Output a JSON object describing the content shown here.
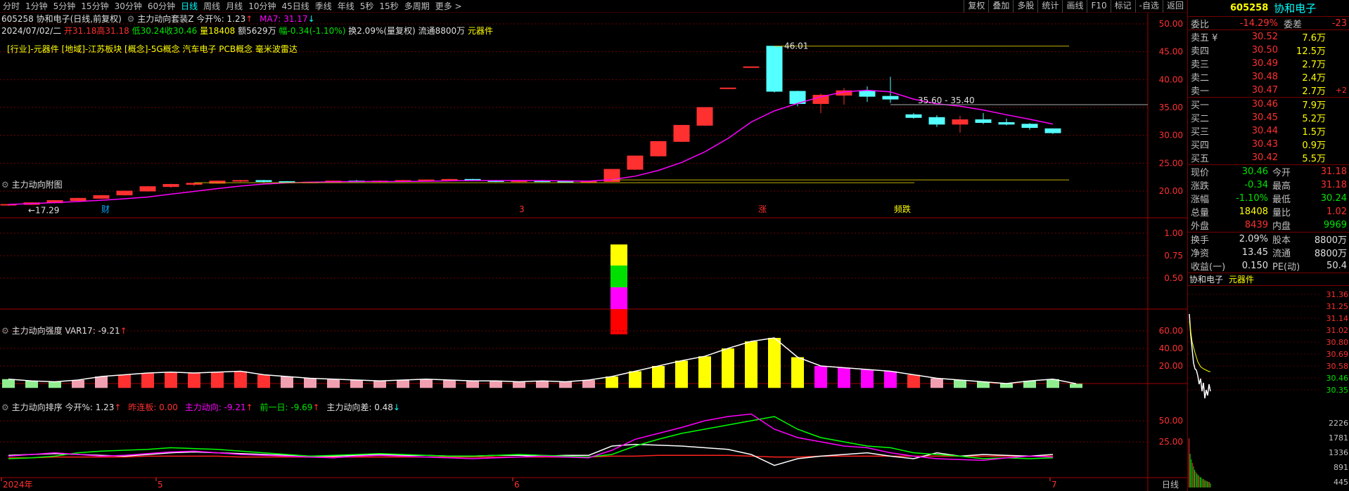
{
  "toolbar": {
    "periods": [
      "分时",
      "1分钟",
      "5分钟",
      "15分钟",
      "30分钟",
      "60分钟",
      "日线",
      "周线",
      "月线",
      "10分钟",
      "45日线",
      "季线",
      "年线",
      "5秒",
      "15秒",
      "多周期",
      "更多 >"
    ],
    "active_period": "日线",
    "tools": [
      "复权",
      "叠加",
      "多股",
      "统计",
      "画线",
      "F10",
      "标记",
      "-自选",
      "返回"
    ]
  },
  "main": {
    "title_stock": "605258 协和电子(日线,前复权)",
    "indicator": "主力动向套装Z",
    "open_pct_label": "今开%: 1.23",
    "ma_label": "MA7: 31.17",
    "quote": {
      "date": "2024/07/02/二",
      "open": "开31.18",
      "high": "高31.18",
      "low": "低30.24",
      "close": "收30.46",
      "vol": "量18408",
      "amount": "额5629万",
      "change": "幅-0.34(-1.10%)",
      "turnover": "换2.09%(量复权)",
      "float": "流通8800万",
      "sector": "元器件"
    },
    "concepts": "[行业]-元器件 [地域]-江苏板块 [概念]-5G概念 汽车电子 PCB概念 毫米波雷达",
    "annotations": {
      "high": "46.01",
      "range": "35.60 - 35.40",
      "low": "17.29"
    },
    "markers": [
      "财",
      "3",
      "涨",
      "频跌"
    ],
    "y_ticks": [
      "50.00",
      "45.00",
      "40.00",
      "35.00",
      "30.00",
      "25.00",
      "20.00"
    ]
  },
  "panels": {
    "fig1": {
      "title": "主力动向附图",
      "y_ticks": [
        "1.00",
        "0.75",
        "0.50"
      ]
    },
    "fig2": {
      "title": "主力动向强度",
      "var": "VAR17: -9.21",
      "y_ticks": [
        "60.00",
        "40.00",
        "20.00"
      ]
    },
    "fig3": {
      "title": "主力动向排序",
      "open": "今开%: 1.23",
      "streak": "昨连板: 0.00",
      "dir": "主力动向: -9.21",
      "prev": "前一日: -9.69",
      "diff": "主力动向差: 0.48",
      "y_ticks": [
        "50.00",
        "25.00"
      ]
    }
  },
  "x_axis": {
    "labels": [
      "2024年",
      "5",
      "6",
      "7"
    ],
    "mode": "日线"
  },
  "colors": {
    "up": "#ff3030",
    "down": "#54ffff",
    "ma": "#ff00ff",
    "grid": "#700000",
    "text": "#c0c0c0"
  },
  "right_panel": {
    "code": "605258",
    "name": "协和电子",
    "ratio": {
      "label": "委比",
      "value": "-14.29%",
      "label2": "委差",
      "value2": "-23"
    },
    "asks": [
      {
        "label": "卖五 ¥",
        "price": "30.52",
        "vol": "7.6万",
        "chg": ""
      },
      {
        "label": "卖四",
        "price": "30.50",
        "vol": "12.5万",
        "chg": ""
      },
      {
        "label": "卖三",
        "price": "30.49",
        "vol": "2.7万",
        "chg": ""
      },
      {
        "label": "卖二",
        "price": "30.48",
        "vol": "2.4万",
        "chg": ""
      },
      {
        "label": "卖一",
        "price": "30.47",
        "vol": "2.7万",
        "chg": "+2"
      }
    ],
    "bids": [
      {
        "label": "买一",
        "price": "30.46",
        "vol": "7.9万"
      },
      {
        "label": "买二",
        "price": "30.45",
        "vol": "5.2万"
      },
      {
        "label": "买三",
        "price": "30.44",
        "vol": "1.5万"
      },
      {
        "label": "买四",
        "price": "30.43",
        "vol": "0.9万"
      },
      {
        "label": "买五",
        "price": "30.42",
        "vol": "5.5万"
      }
    ],
    "stats": [
      {
        "a": "现价",
        "b": "30.46",
        "c": "今开",
        "d": "31.18"
      },
      {
        "a": "涨跌",
        "b": "-0.34",
        "c": "最高",
        "d": "31.18"
      },
      {
        "a": "涨幅",
        "b": "-1.10%",
        "c": "最低",
        "d": "30.24"
      },
      {
        "a": "总量",
        "b": "18408",
        "c": "量比",
        "d": "1.02"
      },
      {
        "a": "外盘",
        "b": "8439",
        "c": "内盘",
        "d": "9969"
      }
    ],
    "stats2": [
      {
        "a": "换手",
        "b": "2.09%",
        "c": "股本",
        "d": "8800万"
      },
      {
        "a": "净资",
        "b": "13.45",
        "c": "流通",
        "d": "8800万"
      },
      {
        "a": "收益(一)",
        "b": "0.150",
        "c": "PE(动)",
        "d": "50.4"
      }
    ],
    "mini": {
      "title": "协和电子",
      "sector": "元器件",
      "price_ticks": [
        "31.36",
        "31.25",
        "31.14",
        "31.02",
        "30.80",
        "30.69",
        "30.58",
        "30.46",
        "30.35"
      ],
      "vol_ticks": [
        "2226",
        "1781",
        "1336",
        "891",
        "445"
      ]
    }
  }
}
